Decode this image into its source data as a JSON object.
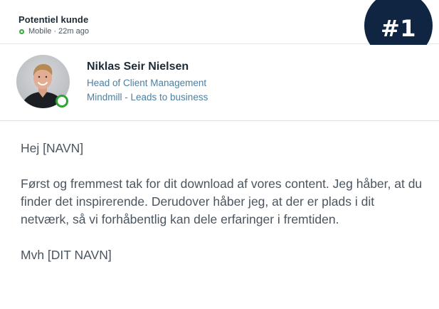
{
  "header": {
    "title": "Potentiel kunde",
    "status": "Mobile · 22m ago"
  },
  "badge": {
    "label": "#1"
  },
  "profile": {
    "name": "Niklas Seir Nielsen",
    "headline": "Head of Client Management",
    "company": "Mindmill - Leads to business"
  },
  "message": {
    "greeting": "Hej [NAVN]",
    "body": "Først og fremmest tak for dit download af vores content. Jeg håber, at du finder det inspirerende. Derudover håber jeg, at der er plads i dit netværk, så vi forhåbentlig kan dele erfaringer i fremtiden.",
    "signoff": "Mvh [DIT NAVN]"
  },
  "colors": {
    "badge_bg": "#0f2541",
    "online_green": "#2fa334",
    "link_blue": "#4d7fa0"
  },
  "icons": {
    "status": "online-status-icon",
    "presence": "presence-indicator-icon"
  }
}
